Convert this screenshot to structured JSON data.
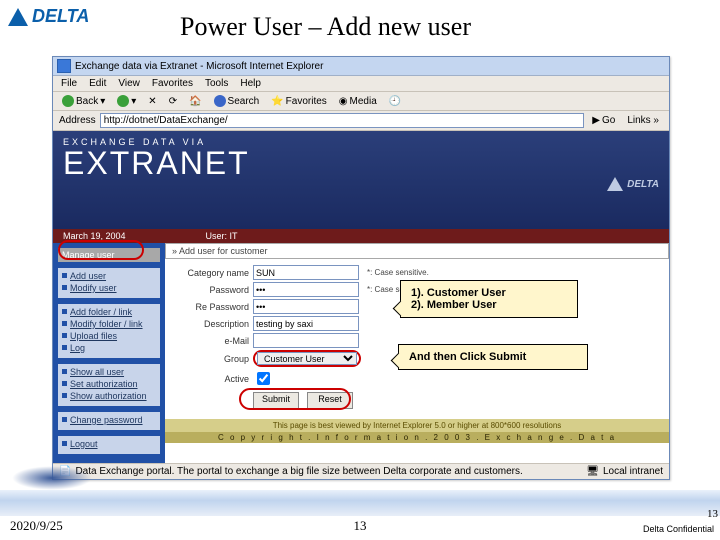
{
  "slide": {
    "brand": "DELTA",
    "title": "Power User – Add new user",
    "date": "2020/9/25",
    "page": "13",
    "page_corner": "13",
    "confidential": "Delta Confidential"
  },
  "browser": {
    "window_title": "Exchange data via Extranet - Microsoft Internet Explorer",
    "menu": [
      "File",
      "Edit",
      "View",
      "Favorites",
      "Tools",
      "Help"
    ],
    "toolbar": {
      "back": "Back",
      "search": "Search",
      "favorites": "Favorites",
      "media": "Media"
    },
    "address_label": "Address",
    "address_value": "http://dotnet/DataExchange/",
    "go": "Go",
    "links": "Links »"
  },
  "banner": {
    "kicker": "EXCHANGE DATA VIA",
    "title": "EXTRANET",
    "brand": "DELTA"
  },
  "redbar": {
    "date": "March 19, 2004",
    "user": "User: IT"
  },
  "sidebar": {
    "groups": [
      {
        "title": "Manage user",
        "items": [
          "Add user",
          "Modify user"
        ]
      },
      {
        "title": null,
        "items": [
          "Add folder / link",
          "Modify folder / link",
          "Upload files",
          "Log"
        ]
      },
      {
        "title": null,
        "items": [
          "Show all user",
          "Set authorization",
          "Show authorization"
        ]
      },
      {
        "title": null,
        "items": [
          "Change password"
        ]
      },
      {
        "title": null,
        "items": [
          "Logout"
        ]
      }
    ]
  },
  "form": {
    "section": "» Add user for customer",
    "fields": {
      "category_name": {
        "label": "Category name",
        "value": "SUN",
        "hint": "*: Case sensitive."
      },
      "password": {
        "label": "Password",
        "value": "•••",
        "hint": "*: Case sensitive."
      },
      "re_password": {
        "label": "Re Password",
        "value": "•••"
      },
      "description": {
        "label": "Description",
        "value": "testing by saxi"
      },
      "email": {
        "label": "e-Mail",
        "value": ""
      },
      "group": {
        "label": "Group",
        "value": "Customer User"
      },
      "active": {
        "label": "Active",
        "checked": true
      }
    },
    "submit": "Submit",
    "reset": "Reset"
  },
  "callouts": {
    "options": "1). Customer User\n2). Member User",
    "action": "And then Click Submit"
  },
  "pagefooter": {
    "line1": "This page is best viewed by Internet Explorer 5.0 or higher at 800*600 resolutions",
    "line2": "C o p y r i g h t .   I n f o r m a t i o n .   2 0 0 3 .   E x c h a n g e .   D a t a"
  },
  "status": {
    "msg": "Data Exchange portal. The portal to exchange a big file size between Delta corporate and customers.",
    "zone": "Local intranet"
  }
}
